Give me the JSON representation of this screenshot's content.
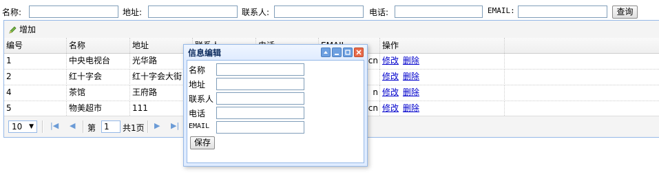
{
  "search": {
    "name_label": "名称:",
    "address_label": "地址:",
    "contact_label": "联系人:",
    "phone_label": "电话:",
    "email_label": "EMAIL:",
    "query_button": "查询"
  },
  "toolbar": {
    "add_label": "增加"
  },
  "grid": {
    "columns": [
      "编号",
      "名称",
      "地址",
      "联系人",
      "电话",
      "EMAIL",
      "操作"
    ],
    "rows": [
      {
        "id": "1",
        "name": "中央电视台",
        "address": "光华路",
        "email_tail": "cn"
      },
      {
        "id": "2",
        "name": "红十字会",
        "address": "红十字会大街",
        "email_tail": ""
      },
      {
        "id": "4",
        "name": "茶馆",
        "address": "王府路",
        "email_tail": "n"
      },
      {
        "id": "5",
        "name": "物美超市",
        "address": "111",
        "email_tail": ". cn"
      }
    ],
    "edit_link": "修改",
    "delete_link": "删除"
  },
  "pager": {
    "page_size": "10",
    "page_prefix": "第",
    "page_number": "1",
    "page_total": "共1页"
  },
  "dialog": {
    "title": "信息编辑",
    "fields": [
      "名称",
      "地址",
      "联系人",
      "电话",
      "EMAIL"
    ],
    "save_label": "保存"
  },
  "colors": {
    "accent_border": "#95b8e7",
    "link": "#0000cc",
    "title_text": "#0e2d5f"
  }
}
